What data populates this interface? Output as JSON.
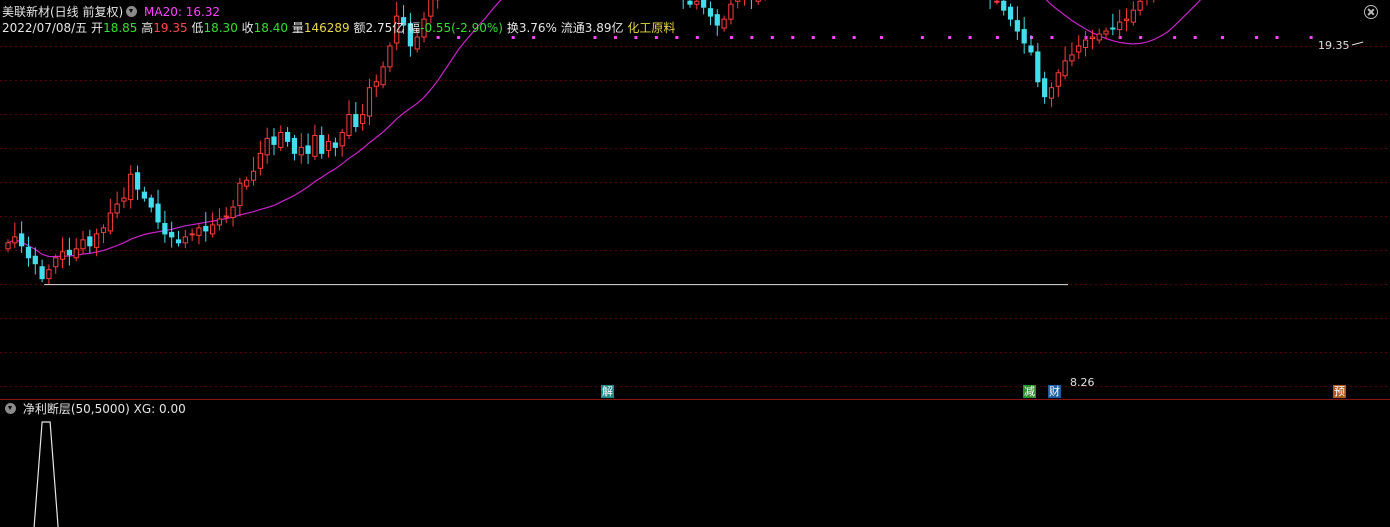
{
  "header": {
    "stock_name": "美联新材(日线 前复权)",
    "ma_label": "MA20: 16.32",
    "date": "2022/07/08/五",
    "open_label": "开",
    "open": "18.85",
    "high_label": "高",
    "high": "19.35",
    "low_label": "低",
    "low": "18.30",
    "close_label": "收",
    "close": "18.40",
    "vol_label": "量",
    "vol": "146289",
    "amt_label": "额",
    "amt": "2.75亿",
    "chg_label": "幅",
    "chg": "-0.55(-2.90%)",
    "turn_label": "换",
    "turn": "3.76%",
    "float_label": "流通",
    "float": "3.89亿",
    "industry": "化工原料"
  },
  "price_labels": {
    "high": "19.35",
    "low": "8.26"
  },
  "events": {
    "jie": "解",
    "jian": "减",
    "cai": "财",
    "yu": "预"
  },
  "subpanel": {
    "title": "净利断层(50,5000)",
    "xg": "XG: 0.00"
  },
  "colors": {
    "up": "#ff3c3c",
    "down": "#44ddee",
    "ma": "#cc22cc",
    "grid": "#5a0000",
    "signal": "#ff44ff"
  },
  "chart_data": {
    "type": "candlestick",
    "ylim": [
      8.0,
      19.8
    ],
    "close_start": 13.0,
    "steps": [
      0.2,
      -0.3,
      -0.4,
      -0.2,
      -0.5,
      0.3,
      0.4,
      0.2,
      -0.1,
      0.2,
      0.3,
      -0.2,
      0.4,
      0.2,
      0.5,
      0.3,
      0.2,
      0.8,
      -0.5,
      -0.3,
      -0.3,
      -0.5,
      -0.4,
      -0.1,
      -0.2,
      0.2,
      0.1,
      0.2,
      -0.1,
      0.2,
      0.2,
      0.1,
      0.3,
      0.8,
      0.1,
      0.3,
      0.6,
      0.5,
      -0.2,
      0.4,
      -0.3,
      -0.4,
      0.2,
      -0.2,
      0.6,
      -0.6,
      0.4,
      -0.2,
      0.5,
      0.6,
      -0.4,
      0.4,
      0.9,
      0.2,
      0.5,
      0.7,
      1.0,
      -0.3,
      -0.7,
      0.3,
      0.6,
      0.7,
      0.9,
      0.8,
      0.4,
      -0.3,
      -0.9,
      -0.5,
      0.4,
      0.3,
      0.2,
      0.1,
      -0.2,
      -0.3,
      0.4,
      0.6,
      0.7,
      0.2,
      0.6,
      0.3,
      0.4,
      -0.4,
      -0.4,
      0.5,
      0.1,
      -0.5,
      -0.6,
      -0.3,
      0.3,
      -0.5,
      -0.7,
      -0.2,
      -0.3,
      -0.1,
      0.2,
      -0.3,
      -0.4,
      -0.2,
      -0.3,
      -0.2,
      0.1,
      -0.2,
      -0.3,
      -0.3,
      0.2,
      0.5,
      0.3,
      0.1,
      -0.2,
      0.1,
      0.1,
      0.2,
      0.2,
      0.1,
      0.3,
      0.1,
      -0.1,
      -0.1,
      0.1,
      -0.1,
      -0.4,
      -0.1,
      0.2,
      0.3,
      -0.5,
      0.4,
      -0.3,
      0.1,
      0.2,
      -0.1,
      0.2,
      0.3,
      0.2,
      -0.2,
      0.1,
      0.2,
      -0.1,
      -0.1,
      -0.1,
      -0.3,
      -0.2,
      -0.2,
      -0.2,
      -0.3,
      -0.1,
      -0.3,
      -0.3,
      -0.4,
      -0.4,
      -0.3,
      -1.0,
      -0.5,
      0.3,
      0.5,
      0.4,
      0.2,
      0.3,
      0.2,
      0.1,
      0.1,
      0.1,
      0.1,
      0.2,
      0.1,
      0.3,
      0.3,
      0.3,
      0.4,
      0.2,
      0.1,
      0.3,
      0.1,
      0.2,
      0.5,
      0.6,
      0.4,
      0.1,
      -0.2,
      0.3,
      0.4,
      0.5,
      0.6,
      0.3,
      0.2,
      0.3,
      0.2,
      0.3,
      0.4,
      1.0,
      1.5,
      0.9,
      0.6,
      -0.5,
      0.7,
      0.8,
      0.5,
      -0.4,
      0.7,
      0.9,
      -0.6
    ],
    "ma_period": 20,
    "signal_marks": [
      63,
      66,
      74,
      77,
      86,
      89,
      92,
      95,
      98,
      101,
      106,
      109,
      112,
      115,
      118,
      121,
      124,
      128,
      134,
      138,
      141,
      145,
      150,
      153,
      158,
      163,
      166,
      171,
      174,
      178,
      183,
      186,
      191
    ]
  }
}
